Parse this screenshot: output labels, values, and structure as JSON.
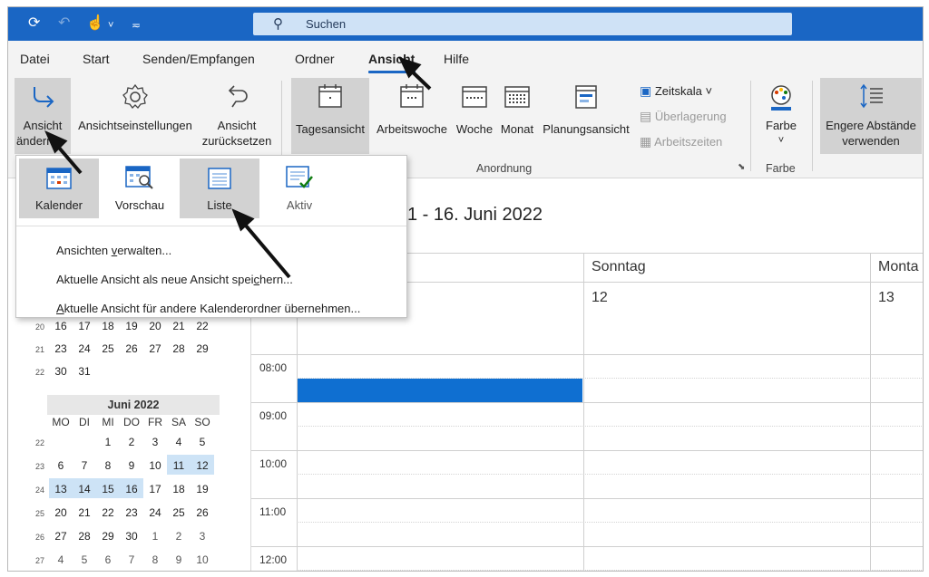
{
  "titlebar": {
    "search_placeholder": "Suchen",
    "quick_access_icons": [
      "sync-icon",
      "undo-icon",
      "touch-mode-icon",
      "dropdown-icon",
      "customize-icon"
    ]
  },
  "menu_tabs": [
    "Datei",
    "Start",
    "Senden/Empfangen",
    "Ordner",
    "Ansicht",
    "Hilfe"
  ],
  "active_tab": "Ansicht",
  "ribbon": {
    "ansicht_aendern": [
      "Ansicht",
      "ändern"
    ],
    "ansichtseinstellungen": "Ansichtseinstellungen",
    "ansicht_zuruecksetzen": [
      "Ansicht",
      "zurücksetzen"
    ],
    "tagesansicht": "Tagesansicht",
    "arbeitswoche": "Arbeitswoche",
    "woche": "Woche",
    "monat": "Monat",
    "planungsansicht": "Planungsansicht",
    "zeitskala": "Zeitskala ˅",
    "ueberlagerung": "Überlagerung",
    "arbeitszeiten": "Arbeitszeiten",
    "group_anordnung": "Anordnung",
    "farbe": "Farbe",
    "farbe_chevron": "˅",
    "group_farbe": "Farbe",
    "engere": [
      "Engere Abstände",
      "verwenden"
    ]
  },
  "dropdown": {
    "tiles": [
      "Kalender",
      "Vorschau",
      "Liste",
      "Aktiv"
    ],
    "items": [
      {
        "pre": "Ansichten ",
        "u": "v",
        "post": "erwalten..."
      },
      {
        "pre": "Aktuelle Ansicht als neue Ansicht spei",
        "u": "c",
        "post": "hern..."
      },
      {
        "pre": "",
        "u": "A",
        "post": "ktuelle Ansicht für andere Kalenderordner übernehmen..."
      }
    ]
  },
  "calendar": {
    "date_range": "1 - 16. Juni 2022",
    "days": [
      {
        "name": "Sonntag",
        "num": "12"
      },
      {
        "name": "Monta",
        "num": "13"
      }
    ],
    "times": [
      "08:00",
      "09:00",
      "10:00",
      "11:00",
      "12:00"
    ]
  },
  "mini_calendar": {
    "may_rows": [
      {
        "wk": "20",
        "days": [
          "16",
          "17",
          "18",
          "19",
          "20",
          "21",
          "22"
        ]
      },
      {
        "wk": "21",
        "days": [
          "23",
          "24",
          "25",
          "26",
          "27",
          "28",
          "29"
        ]
      },
      {
        "wk": "22",
        "days": [
          "30",
          "31",
          "",
          "",
          "",
          "",
          ""
        ]
      }
    ],
    "month_title": "Juni 2022",
    "weekdays": [
      "MO",
      "DI",
      "MI",
      "DO",
      "FR",
      "SA",
      "SO"
    ],
    "june_rows": [
      {
        "wk": "22",
        "days": [
          "",
          "",
          "1",
          "2",
          "3",
          "4",
          "5"
        ]
      },
      {
        "wk": "23",
        "days": [
          "6",
          "7",
          "8",
          "9",
          "10",
          "11",
          "12"
        ]
      },
      {
        "wk": "24",
        "days": [
          "13",
          "14",
          "15",
          "16",
          "17",
          "18",
          "19"
        ]
      },
      {
        "wk": "25",
        "days": [
          "20",
          "21",
          "22",
          "23",
          "24",
          "25",
          "26"
        ]
      },
      {
        "wk": "26",
        "days": [
          "27",
          "28",
          "29",
          "30",
          "1",
          "2",
          "3"
        ]
      },
      {
        "wk": "27",
        "days": [
          "4",
          "5",
          "6",
          "7",
          "8",
          "9",
          "10"
        ]
      }
    ]
  },
  "colors": {
    "accent": "#1a66c4",
    "event": "#0f6fd1",
    "highlight": "#cde3f6"
  }
}
